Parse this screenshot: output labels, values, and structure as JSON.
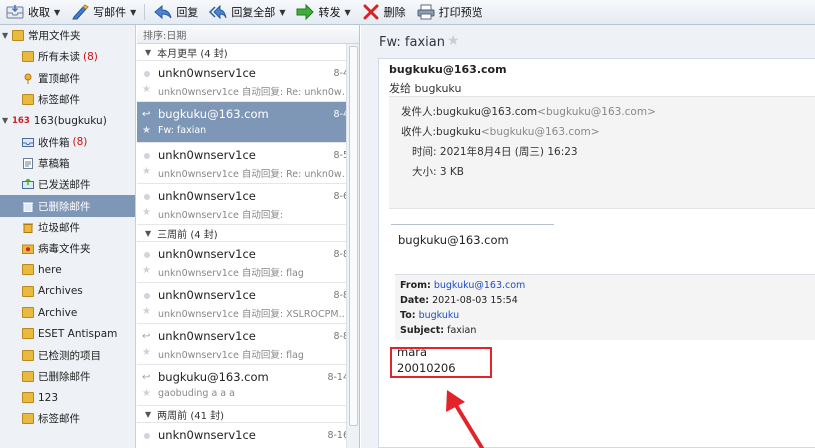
{
  "toolbar": {
    "receive": "收取",
    "compose": "写邮件",
    "reply": "回复",
    "reply_all": "回复全部",
    "forward": "转发",
    "delete": "删除",
    "print_preview": "打印预览"
  },
  "sidebar": {
    "common_folders": "常用文件夹",
    "all_unread": "所有未读",
    "all_unread_count": "(8)",
    "pinned": "置顶邮件",
    "tagged": "标签邮件",
    "account_badge": "163",
    "account": "163(bugkuku)",
    "inbox": "收件箱",
    "inbox_count": "(8)",
    "drafts": "草稿箱",
    "sent": "已发送邮件",
    "deleted": "已删除邮件",
    "junk": "垃圾邮件",
    "virus": "病毒文件夹",
    "here": "here",
    "archives": "Archives",
    "archive": "Archive",
    "eset": "ESET Antispam",
    "detected": "已检测的项目",
    "deleted2": "已删除邮件",
    "num123": "123",
    "tagged2": "标签邮件"
  },
  "list": {
    "sort_label": "排序:日期",
    "groups": [
      "本月更早 (4 封)",
      "三周前 (4 封)",
      "两周前 (41 封)"
    ],
    "rows": [
      {
        "sender": "unkn0wnserv1ce",
        "date": "8-4",
        "preview": "unkn0wnserv1ce 自动回复: Re: unkn0wnse..."
      },
      {
        "sender": "bugkuku@163.com",
        "date": "8-4",
        "preview": "Fw: faxian"
      },
      {
        "sender": "unkn0wnserv1ce",
        "date": "8-5",
        "preview": "unkn0wnserv1ce 自动回复: Re: unkn0wnse..."
      },
      {
        "sender": "unkn0wnserv1ce",
        "date": "8-6",
        "preview": "unkn0wnserv1ce 自动回复:"
      },
      {
        "sender": "unkn0wnserv1ce",
        "date": "8-8",
        "preview": "unkn0wnserv1ce 自动回复: flag"
      },
      {
        "sender": "unkn0wnserv1ce",
        "date": "8-8",
        "preview": "unkn0wnserv1ce 自动回复: XSLROCPMN..."
      },
      {
        "sender": "unkn0wnserv1ce",
        "date": "8-8",
        "preview": "unkn0wnserv1ce 自动回复: flag"
      },
      {
        "sender": "bugkuku@163.com",
        "date": "8-14",
        "preview": "gaobuding a a a"
      },
      {
        "sender": "unkn0wnserv1ce",
        "date": "8-16",
        "preview": ""
      }
    ]
  },
  "reader": {
    "title": "Fw: faxian",
    "from_header": "bugkuku@163.com",
    "to_line": "发给 bugkuku",
    "meta": {
      "from_label": "发件人:",
      "from_name": "bugkuku@163.com",
      "from_addr": "<bugkuku@163.com>",
      "to_label": "收件人:",
      "to_name": "bugkuku",
      "to_addr": "<bugkuku@163.com>",
      "time_label": "时间:",
      "time_value": "2021年8月4日 (周三) 16:23",
      "size_label": "大小:",
      "size_value": "3 KB"
    },
    "body_sender": "bugkuku@163.com",
    "quote": {
      "from_label": "From:",
      "from_value": "bugkuku@163.com",
      "date_label": "Date:",
      "date_value": "2021-08-03 15:54",
      "to_label": "To:",
      "to_value": "bugkuku",
      "subject_label": "Subject:",
      "subject_value": "faxian"
    },
    "body_line1": "mara",
    "body_line2": "20010206"
  },
  "colors": {
    "selected": "#7f97b7",
    "annotation": "#e3232a",
    "link": "#1a4fc2"
  }
}
